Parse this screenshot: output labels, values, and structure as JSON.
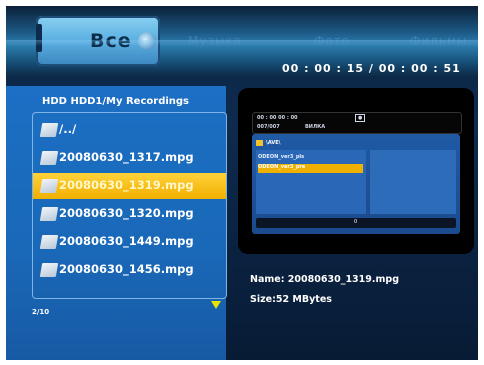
{
  "tabs": [
    {
      "label": "Все"
    },
    {
      "label": "Музыка"
    },
    {
      "label": "Фото"
    },
    {
      "label": "Фильмы"
    }
  ],
  "time": "00 : 00 : 15 / 00 : 00 : 51",
  "path": {
    "label": "HDD  HDD1/My Recordings"
  },
  "list": {
    "items": [
      {
        "label": "/../"
      },
      {
        "label": "20080630_1317.mpg"
      },
      {
        "label": "20080630_1319.mpg"
      },
      {
        "label": "20080630_1320.mpg"
      },
      {
        "label": "20080630_1449.mpg"
      },
      {
        "label": "20080630_1456.mpg"
      }
    ],
    "count": "2/10"
  },
  "preview": {
    "time_left": "00 : 00   00 : 00",
    "track": "007/007",
    "label_mid": "ВИЛКА",
    "folder": "\\AVE\\",
    "items": [
      {
        "label": "ODEON_ver3_pls"
      },
      {
        "label": "ODEON_ver3_pre"
      }
    ],
    "bar_text": "0"
  },
  "info": {
    "name": "Name: 20080630_1319.mpg",
    "size": "Size:52 MBytes"
  }
}
